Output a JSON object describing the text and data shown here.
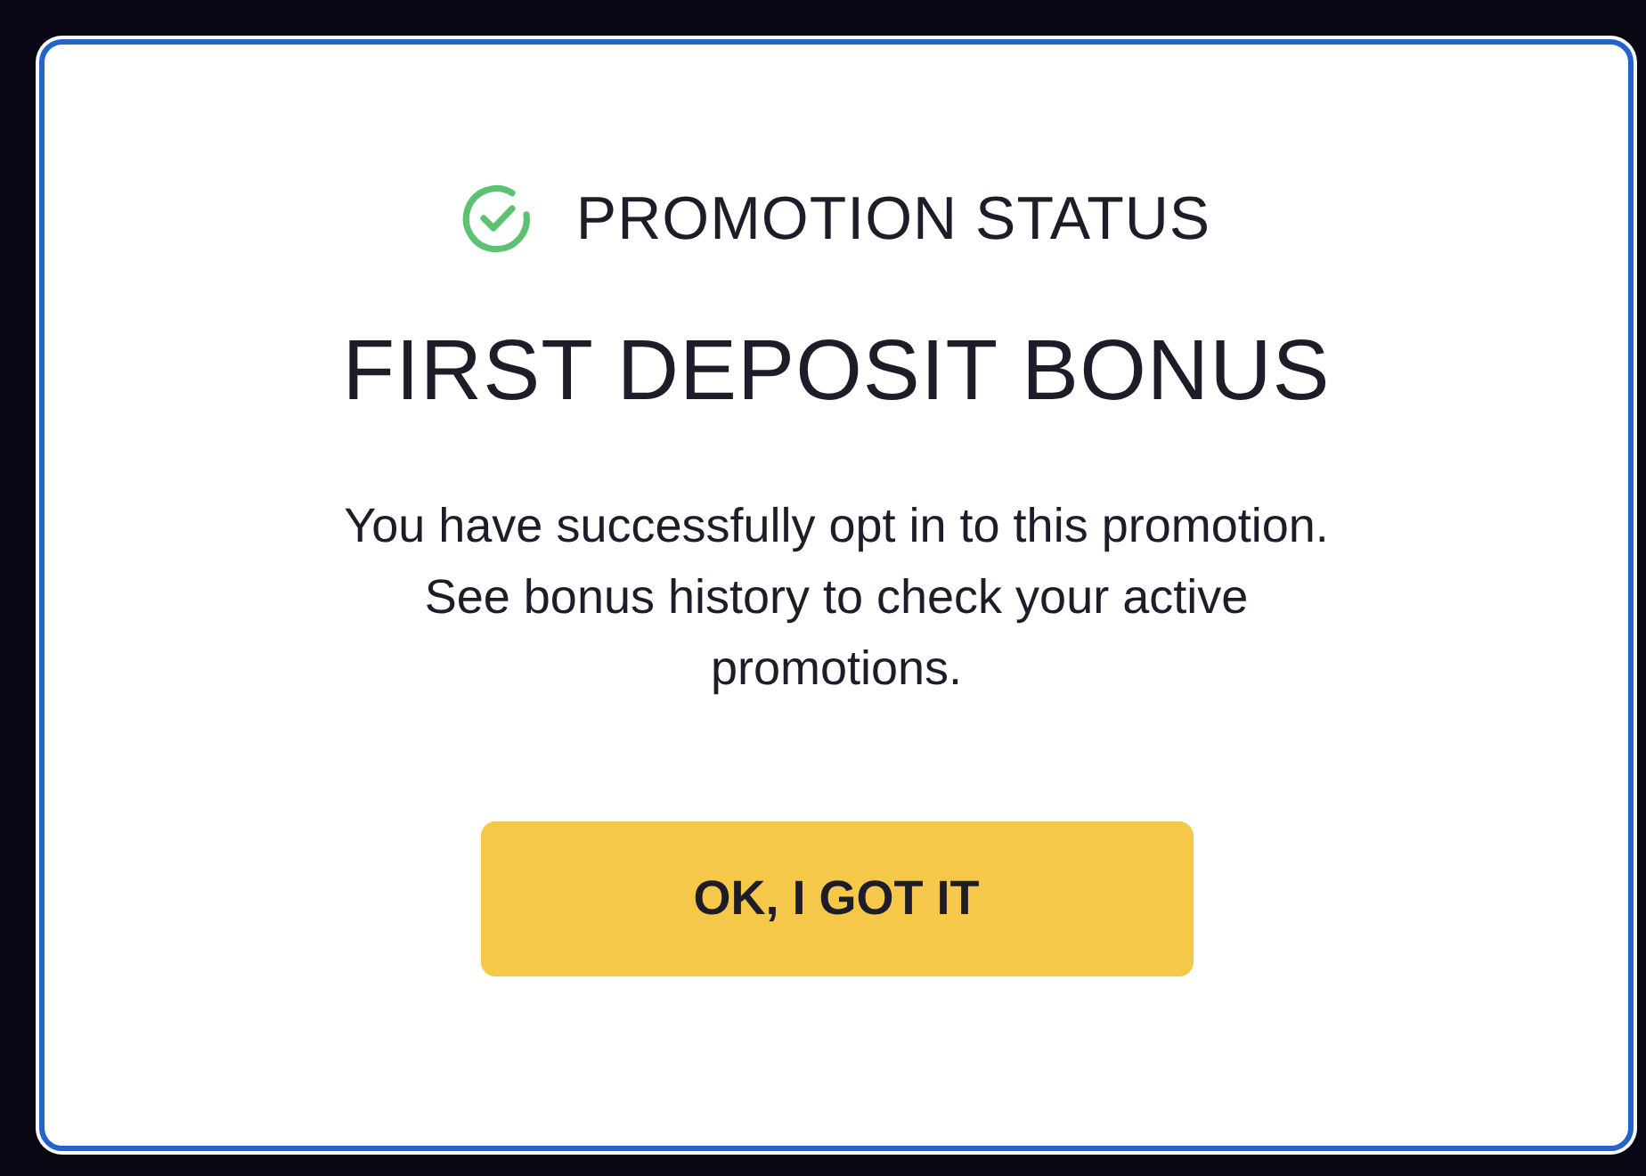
{
  "dialog": {
    "status": {
      "kind": "success",
      "label": "PROMOTION STATUS"
    },
    "title": "FIRST DEPOSIT BONUS",
    "message": "You have successfully opt in to this promotion. See bonus history to check your active promotions.",
    "button": {
      "label": "OK, I GOT IT"
    }
  }
}
